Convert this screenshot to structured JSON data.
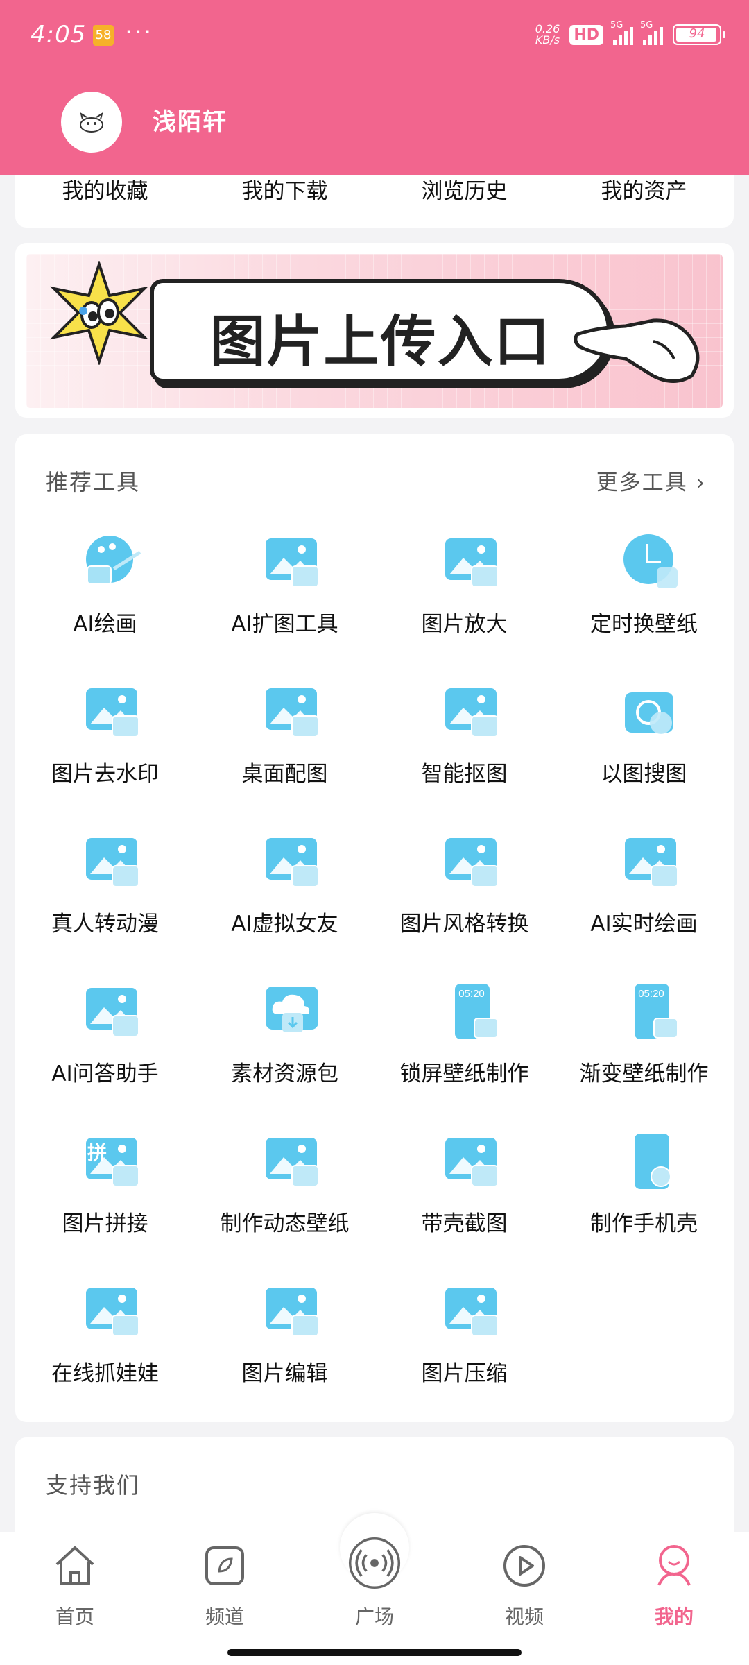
{
  "status_bar": {
    "time": "4:05",
    "badge": "58",
    "more": "···",
    "net_speed_value": "0.26",
    "net_speed_unit": "KB/s",
    "hd_label": "HD",
    "signal1_label": "5G",
    "signal2_label": "5G",
    "battery": "94"
  },
  "profile": {
    "username": "浅陌轩"
  },
  "quick_links": [
    {
      "label": "我的收藏"
    },
    {
      "label": "我的下载"
    },
    {
      "label": "浏览历史"
    },
    {
      "label": "我的资产"
    }
  ],
  "banner": {
    "text": "图片上传入口"
  },
  "tools_section": {
    "title": "推荐工具",
    "more_label": "更多工具",
    "chevron": "›",
    "items": [
      {
        "label": "AI绘画",
        "icon": "palette-ai-icon"
      },
      {
        "label": "AI扩图工具",
        "icon": "expand-image-icon"
      },
      {
        "label": "图片放大",
        "icon": "image-zoom-icon"
      },
      {
        "label": "定时换壁纸",
        "icon": "clock-icon"
      },
      {
        "label": "图片去水印",
        "icon": "watermark-remove-icon"
      },
      {
        "label": "桌面配图",
        "icon": "desktop-image-icon"
      },
      {
        "label": "智能抠图",
        "icon": "smart-cutout-icon"
      },
      {
        "label": "以图搜图",
        "icon": "camera-search-icon"
      },
      {
        "label": "真人转动漫",
        "icon": "portrait-anime-icon"
      },
      {
        "label": "AI虚拟女友",
        "icon": "virtual-girlfriend-icon"
      },
      {
        "label": "图片风格转换",
        "icon": "style-transfer-icon"
      },
      {
        "label": "AI实时绘画",
        "icon": "realtime-drawing-icon"
      },
      {
        "label": "AI问答助手",
        "icon": "chat-assistant-icon"
      },
      {
        "label": "素材资源包",
        "icon": "cloud-download-icon"
      },
      {
        "label": "锁屏壁纸制作",
        "icon": "lockscreen-wallpaper-icon",
        "phone_time": "05:20"
      },
      {
        "label": "渐变壁纸制作",
        "icon": "gradient-wallpaper-icon",
        "phone_time": "05:20"
      },
      {
        "label": "图片拼接",
        "icon": "image-stitch-icon",
        "glyph": "拼"
      },
      {
        "label": "制作动态壁纸",
        "icon": "video-wallpaper-icon"
      },
      {
        "label": "带壳截图",
        "icon": "device-frame-icon"
      },
      {
        "label": "制作手机壳",
        "icon": "phone-case-icon"
      },
      {
        "label": "在线抓娃娃",
        "icon": "claw-machine-icon"
      },
      {
        "label": "图片编辑",
        "icon": "image-edit-icon"
      },
      {
        "label": "图片压缩",
        "icon": "image-compress-icon"
      }
    ]
  },
  "support_section": {
    "title": "支持我们"
  },
  "bottom_nav": [
    {
      "label": "首页",
      "icon": "home-icon",
      "active": false
    },
    {
      "label": "频道",
      "icon": "channel-icon",
      "active": false
    },
    {
      "label": "广场",
      "icon": "broadcast-icon",
      "active": false
    },
    {
      "label": "视频",
      "icon": "play-icon",
      "active": false
    },
    {
      "label": "我的",
      "icon": "profile-icon",
      "active": true
    }
  ],
  "colors": {
    "brand_pink": "#f2658e",
    "icon_blue": "#5bc8ee"
  }
}
